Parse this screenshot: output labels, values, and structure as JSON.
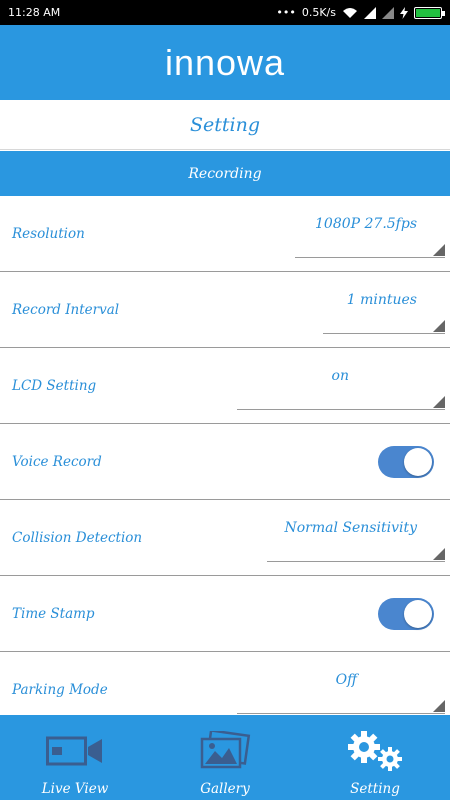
{
  "status_bar": {
    "time": "11:28 AM",
    "network_speed": "0.5K/s",
    "icons": [
      "more-icon",
      "wifi-icon",
      "signal-icon",
      "signal-icon",
      "charging-icon",
      "battery-icon"
    ]
  },
  "app_bar": {
    "logo": "innowa"
  },
  "page": {
    "title": "Setting"
  },
  "section": {
    "title": "Recording"
  },
  "settings": {
    "resolution": {
      "label": "Resolution",
      "value": "1080P 27.5fps"
    },
    "record_interval": {
      "label": "Record Interval",
      "value": "1 mintues"
    },
    "lcd_setting": {
      "label": "LCD Setting",
      "value": "on"
    },
    "voice_record": {
      "label": "Voice Record",
      "enabled": true
    },
    "collision_detection": {
      "label": "Collision Detection",
      "value": "Normal Sensitivity"
    },
    "time_stamp": {
      "label": "Time Stamp",
      "enabled": true
    },
    "parking_mode": {
      "label": "Parking Mode",
      "value": "Off"
    }
  },
  "bottom_nav": {
    "items": [
      {
        "label": "Live View",
        "icon": "video-camera-icon",
        "active": false
      },
      {
        "label": "Gallery",
        "icon": "gallery-icon",
        "active": false
      },
      {
        "label": "Setting",
        "icon": "gears-icon",
        "active": true
      }
    ]
  },
  "colors": {
    "accent": "#2a97e0",
    "text_blue": "#2a8fd8",
    "toggle_on": "#4a86cf",
    "battery": "#22c040"
  }
}
